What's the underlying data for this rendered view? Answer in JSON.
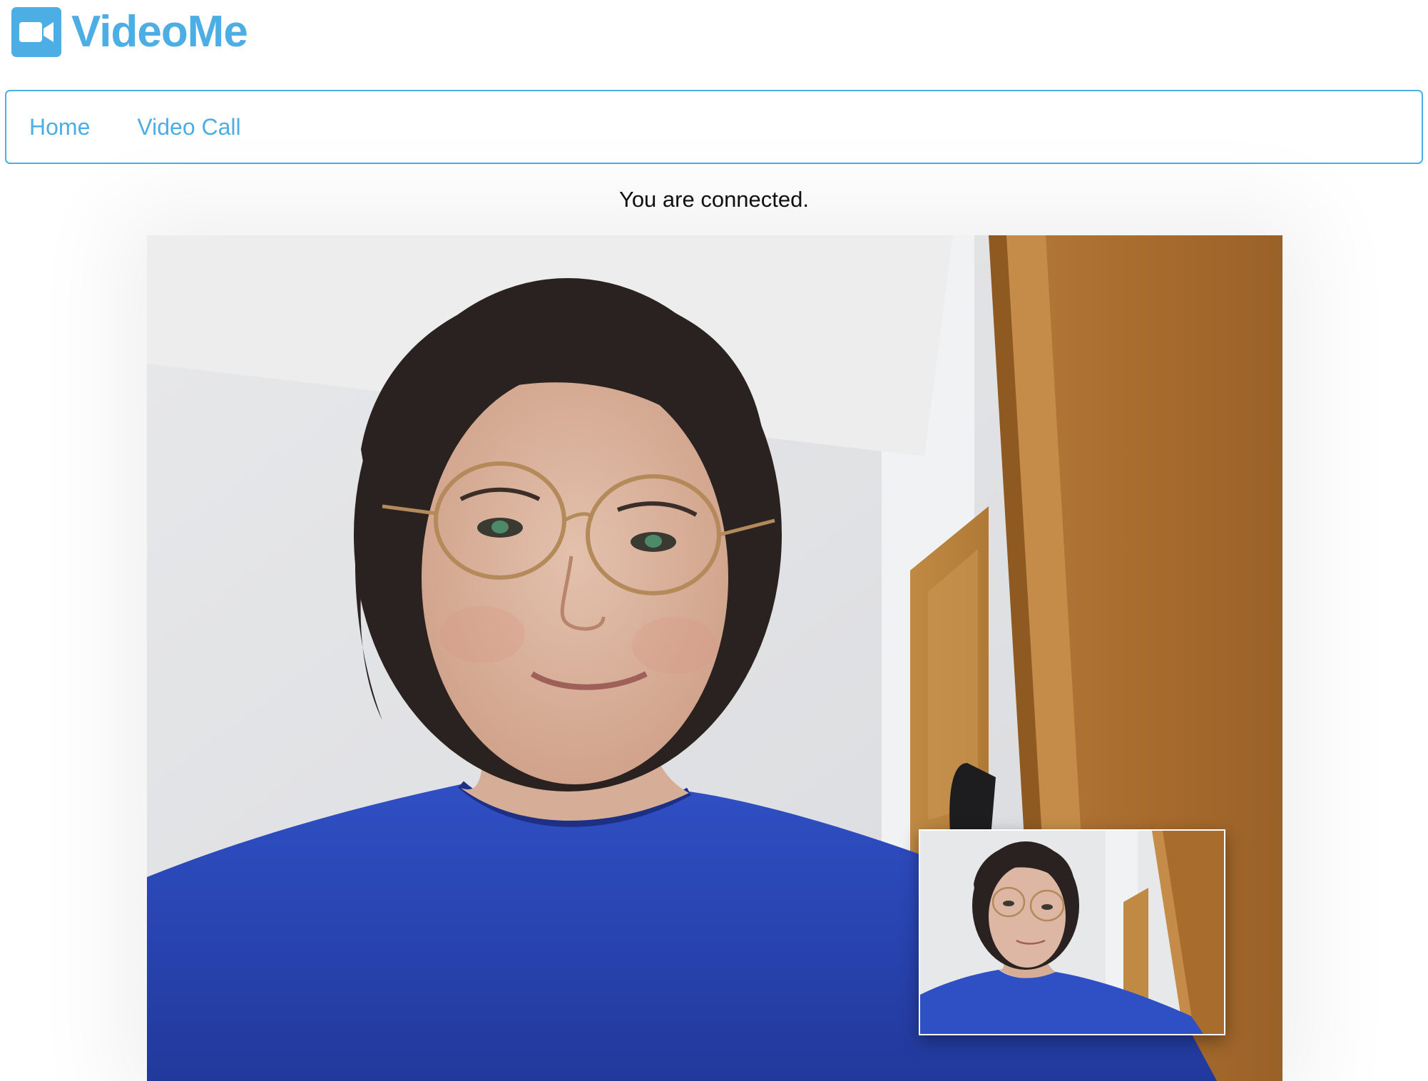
{
  "app": {
    "name": "VideoMe",
    "brand_color": "#4dade5",
    "logo_icon": "video-camera-icon"
  },
  "nav": {
    "items": [
      {
        "label": "Home"
      },
      {
        "label": "Video Call"
      }
    ]
  },
  "call": {
    "status": "You are connected."
  },
  "colors": {
    "accent": "#4dade5",
    "text": "#111111",
    "background": "#ffffff"
  }
}
